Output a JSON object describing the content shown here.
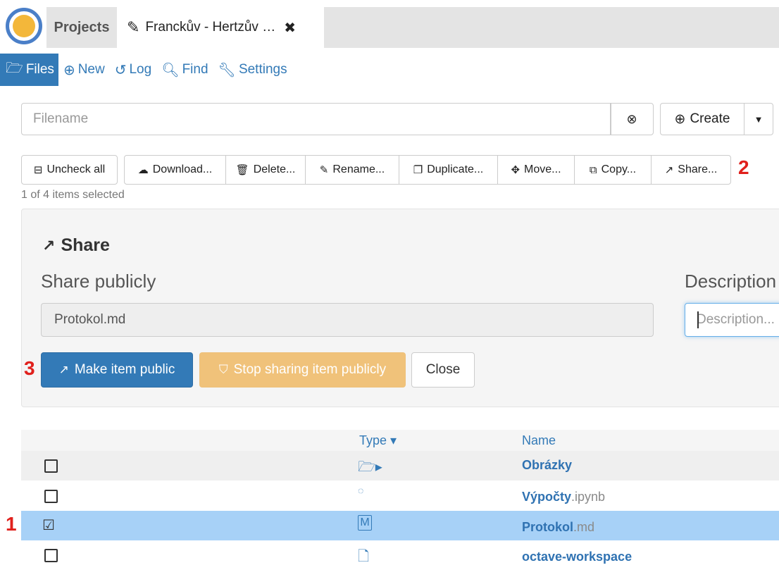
{
  "topbar": {
    "projects_label": "Projects",
    "tab_title": "Franckův - Hertzův …",
    "tab_icon": "edit-icon",
    "close_icon": "close-icon"
  },
  "nav": [
    {
      "label": "Files",
      "icon": "folder-open-icon",
      "active": true
    },
    {
      "label": "New",
      "icon": "plus-circle-icon"
    },
    {
      "label": "Log",
      "icon": "history-icon"
    },
    {
      "label": "Find",
      "icon": "search-icon"
    },
    {
      "label": "Settings",
      "icon": "wrench-icon"
    }
  ],
  "search": {
    "placeholder": "Filename"
  },
  "create": {
    "label": "Create"
  },
  "actions": [
    {
      "label": "Uncheck all",
      "icon": "minus-square-icon"
    },
    {
      "label": "Download...",
      "icon": "cloud-download-icon"
    },
    {
      "label": "Delete...",
      "icon": "trash-icon"
    },
    {
      "label": "Rename...",
      "icon": "pencil-icon"
    },
    {
      "label": "Duplicate...",
      "icon": "clone-icon"
    },
    {
      "label": "Move...",
      "icon": "move-icon"
    },
    {
      "label": "Copy...",
      "icon": "copy-icon"
    },
    {
      "label": "Share...",
      "icon": "share-icon"
    }
  ],
  "selection_text": "1 of 4 items selected",
  "annotations": {
    "a1": "1",
    "a2": "2",
    "a3": "3"
  },
  "share": {
    "title": "Share",
    "share_publicly": "Share publicly",
    "description_label": "Description",
    "path_value": "Protokol.md",
    "description_placeholder": "Description...",
    "make_public": "Make item public",
    "stop_sharing": "Stop sharing item publicly",
    "close": "Close"
  },
  "table": {
    "headers": {
      "type": "Type",
      "name": "Name"
    },
    "rows": [
      {
        "type_icon": "folder-icon",
        "name": "Obrázky",
        "ext": "",
        "checked": false
      },
      {
        "type_icon": "jupyter-icon",
        "name": "Výpočty",
        "ext": ".ipynb",
        "checked": false
      },
      {
        "type_icon": "markdown-icon",
        "name": "Protokol",
        "ext": ".md",
        "checked": true
      },
      {
        "type_icon": "file-icon",
        "name": "octave-workspace",
        "ext": "",
        "checked": false
      }
    ]
  },
  "colors": {
    "primary": "#337ab7",
    "warning": "#f0c27a",
    "selected_row": "#a7d1f7",
    "annotation": "#e0201c"
  }
}
